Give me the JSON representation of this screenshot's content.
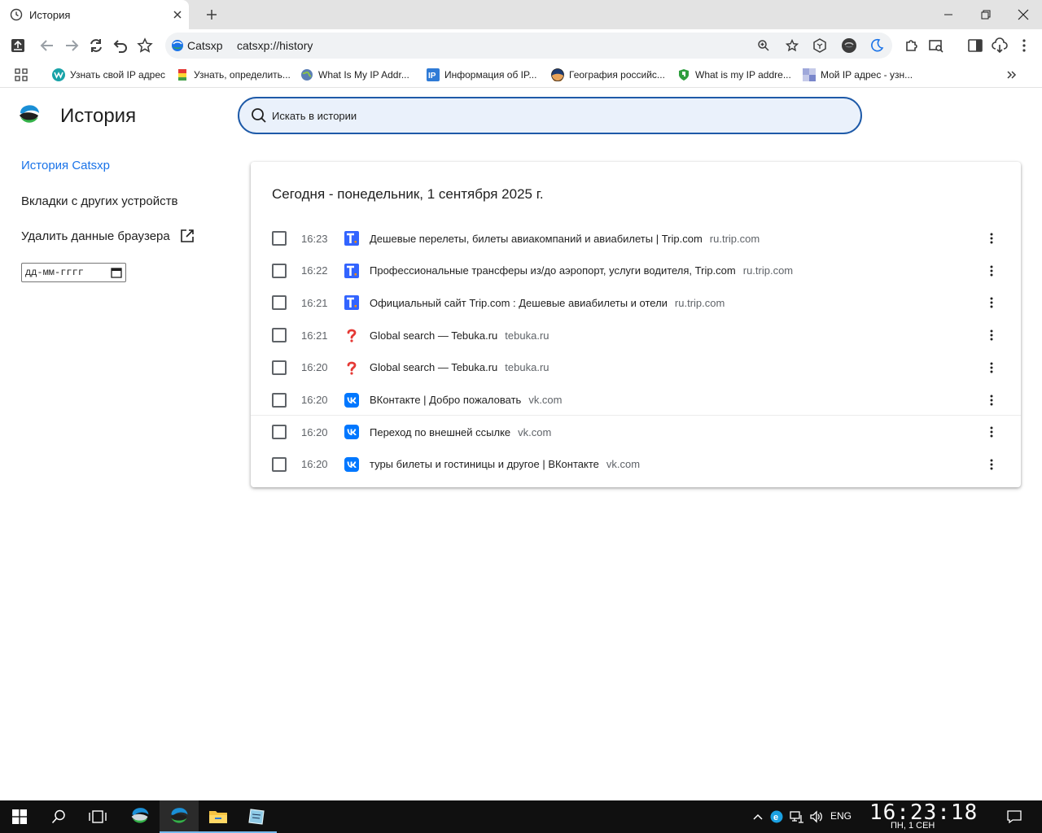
{
  "tab": {
    "title": "История"
  },
  "omnibox": {
    "chip_label": "Catsxp",
    "url": "catsxp://history"
  },
  "bookmarks": [
    {
      "label": "Узнать свой IP адрес",
      "icon": "w-icon"
    },
    {
      "label": "Узнать, определить...",
      "icon": "flag-icon"
    },
    {
      "label": "What Is My IP Addr...",
      "icon": "globe-icon"
    },
    {
      "label": "Информация об IP...",
      "icon": "ip-icon"
    },
    {
      "label": "География российс...",
      "icon": "earth-icon"
    },
    {
      "label": "What is my IP addre...",
      "icon": "shield-icon"
    },
    {
      "label": "Мой IP адрес - узн...",
      "icon": "pixel-icon"
    }
  ],
  "page": {
    "title": "История",
    "search_placeholder": "Искать в истории",
    "nav": {
      "history": "История Catsxp",
      "other_devices": "Вкладки с других устройств",
      "clear_data": "Удалить данные браузера"
    },
    "date_placeholder": "дд-мм-гггг"
  },
  "history": {
    "header": "Сегодня - понедельник, 1 сентября 2025 г.",
    "items": [
      {
        "time": "16:23",
        "title": "Дешевые перелеты, билеты авиакомпаний и авиабилеты | Trip.com",
        "domain": "ru.trip.com",
        "icon": "trip"
      },
      {
        "time": "16:22",
        "title": "Профессиональные трансферы из/до аэропорт, услуги водителя, Trip.com",
        "domain": "ru.trip.com",
        "icon": "trip"
      },
      {
        "time": "16:21",
        "title": "Официальный сайт Trip.com : Дешевые авиабилеты и отели",
        "domain": "ru.trip.com",
        "icon": "trip"
      },
      {
        "time": "16:21",
        "title": "Global search — Tebuka.ru",
        "domain": "tebuka.ru",
        "icon": "question"
      },
      {
        "time": "16:20",
        "title": "Global search — Tebuka.ru",
        "domain": "tebuka.ru",
        "icon": "question"
      },
      {
        "time": "16:20",
        "title": "ВКонтакте | Добро пожаловать",
        "domain": "vk.com",
        "icon": "vk"
      },
      {
        "time": "16:20",
        "title": "Переход по внешней ссылке",
        "domain": "vk.com",
        "icon": "vk"
      },
      {
        "time": "16:20",
        "title": "туры билеты и гостиницы и другое | ВКонтакте",
        "domain": "vk.com",
        "icon": "vk"
      }
    ]
  },
  "taskbar": {
    "lang": "ENG",
    "time": "16:23:18",
    "date": "ПН, 1   СЕН"
  },
  "colors": {
    "accent": "#1a73e8",
    "trip_blue": "#3264ff",
    "vk_blue": "#0077ff",
    "search_border": "#1e5aa8"
  }
}
